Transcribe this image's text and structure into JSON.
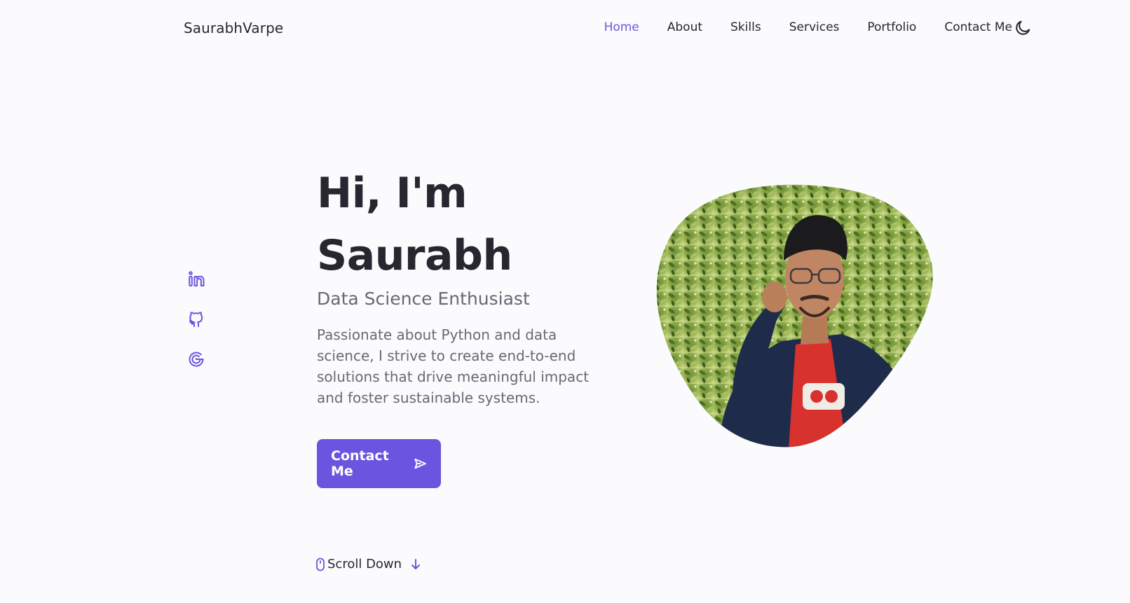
{
  "brand": {
    "logo_text": "SaurabhVarpe"
  },
  "nav": {
    "items": [
      {
        "label": "Home",
        "active": true
      },
      {
        "label": "About"
      },
      {
        "label": "Skills"
      },
      {
        "label": "Services"
      },
      {
        "label": "Portfolio"
      },
      {
        "label": "Contact Me"
      }
    ],
    "theme_icon": "moon-icon"
  },
  "social": [
    {
      "icon": "linkedin-icon"
    },
    {
      "icon": "github-icon"
    },
    {
      "icon": "google-icon"
    }
  ],
  "hero": {
    "title_line1": "Hi, I'm",
    "title_line2": "Saurabh",
    "subtitle": "Data Science Enthusiast",
    "description": "Passionate about Python and data science, I strive to create end-to-end solutions that drive meaningful impact and foster sustainable systems.",
    "cta_label": "Contact Me"
  },
  "scroll": {
    "label": "Scroll Down"
  },
  "colors": {
    "accent": "#6b55e0",
    "nav_active": "#6b5ad6",
    "text": "#28262f",
    "muted": "#6b6874",
    "background": "#fbfafd"
  }
}
